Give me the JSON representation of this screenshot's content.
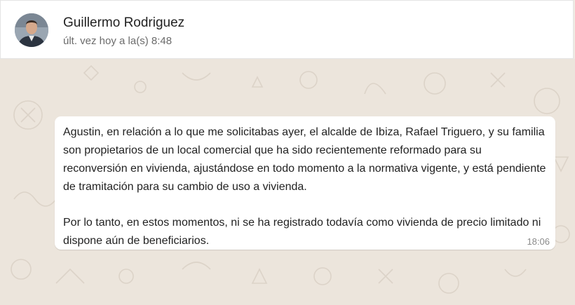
{
  "contact": {
    "name": "Guillermo Rodriguez",
    "status": "últ. vez hoy a la(s) 8:48",
    "avatar_icon": "person-avatar-icon"
  },
  "message": {
    "paragraph1": "Agustin, en relación a lo que me solicitabas ayer, el alcalde de Ibiza, Rafael Triguero, y su familia son propietarios de un local comercial que ha sido recientemente reformado para su reconversión en vivienda, ajustándose en todo momento a la normativa vigente, y está pendiente de tramitación para su cambio de uso a vivienda.",
    "paragraph2": "Por lo tanto, en estos momentos, ni se ha registrado todavía como vivienda de precio limitado ni dispone aún de beneficiarios.",
    "time": "18:06"
  },
  "colors": {
    "chat_background": "#ece5dc",
    "bubble": "#ffffff",
    "header": "#ffffff"
  }
}
